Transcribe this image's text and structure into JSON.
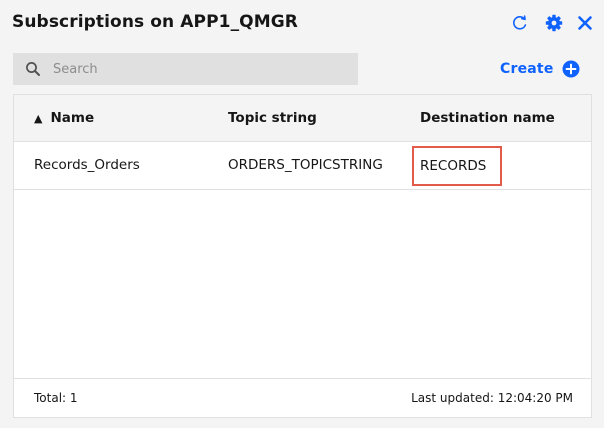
{
  "header": {
    "title": "Subscriptions on APP1_QMGR",
    "icons": [
      "refresh-icon",
      "gear-icon",
      "close-icon"
    ]
  },
  "search": {
    "placeholder": "Search",
    "value": ""
  },
  "create": {
    "label": "Create",
    "icon": "add-circle-icon"
  },
  "table": {
    "sort_indicator": "▲",
    "columns": [
      "Name",
      "Topic string",
      "Destination name"
    ],
    "rows": [
      {
        "name": "Records_Orders",
        "topic_string": "ORDERS_TOPICSTRING",
        "destination": "RECORDS"
      }
    ]
  },
  "footer": {
    "total": "Total: 1",
    "last_updated": "Last updated: 12:04:20 PM"
  },
  "colors": {
    "accent": "#0f62fe",
    "highlight_border": "#e25a4a",
    "background": "#f4f4f4"
  }
}
